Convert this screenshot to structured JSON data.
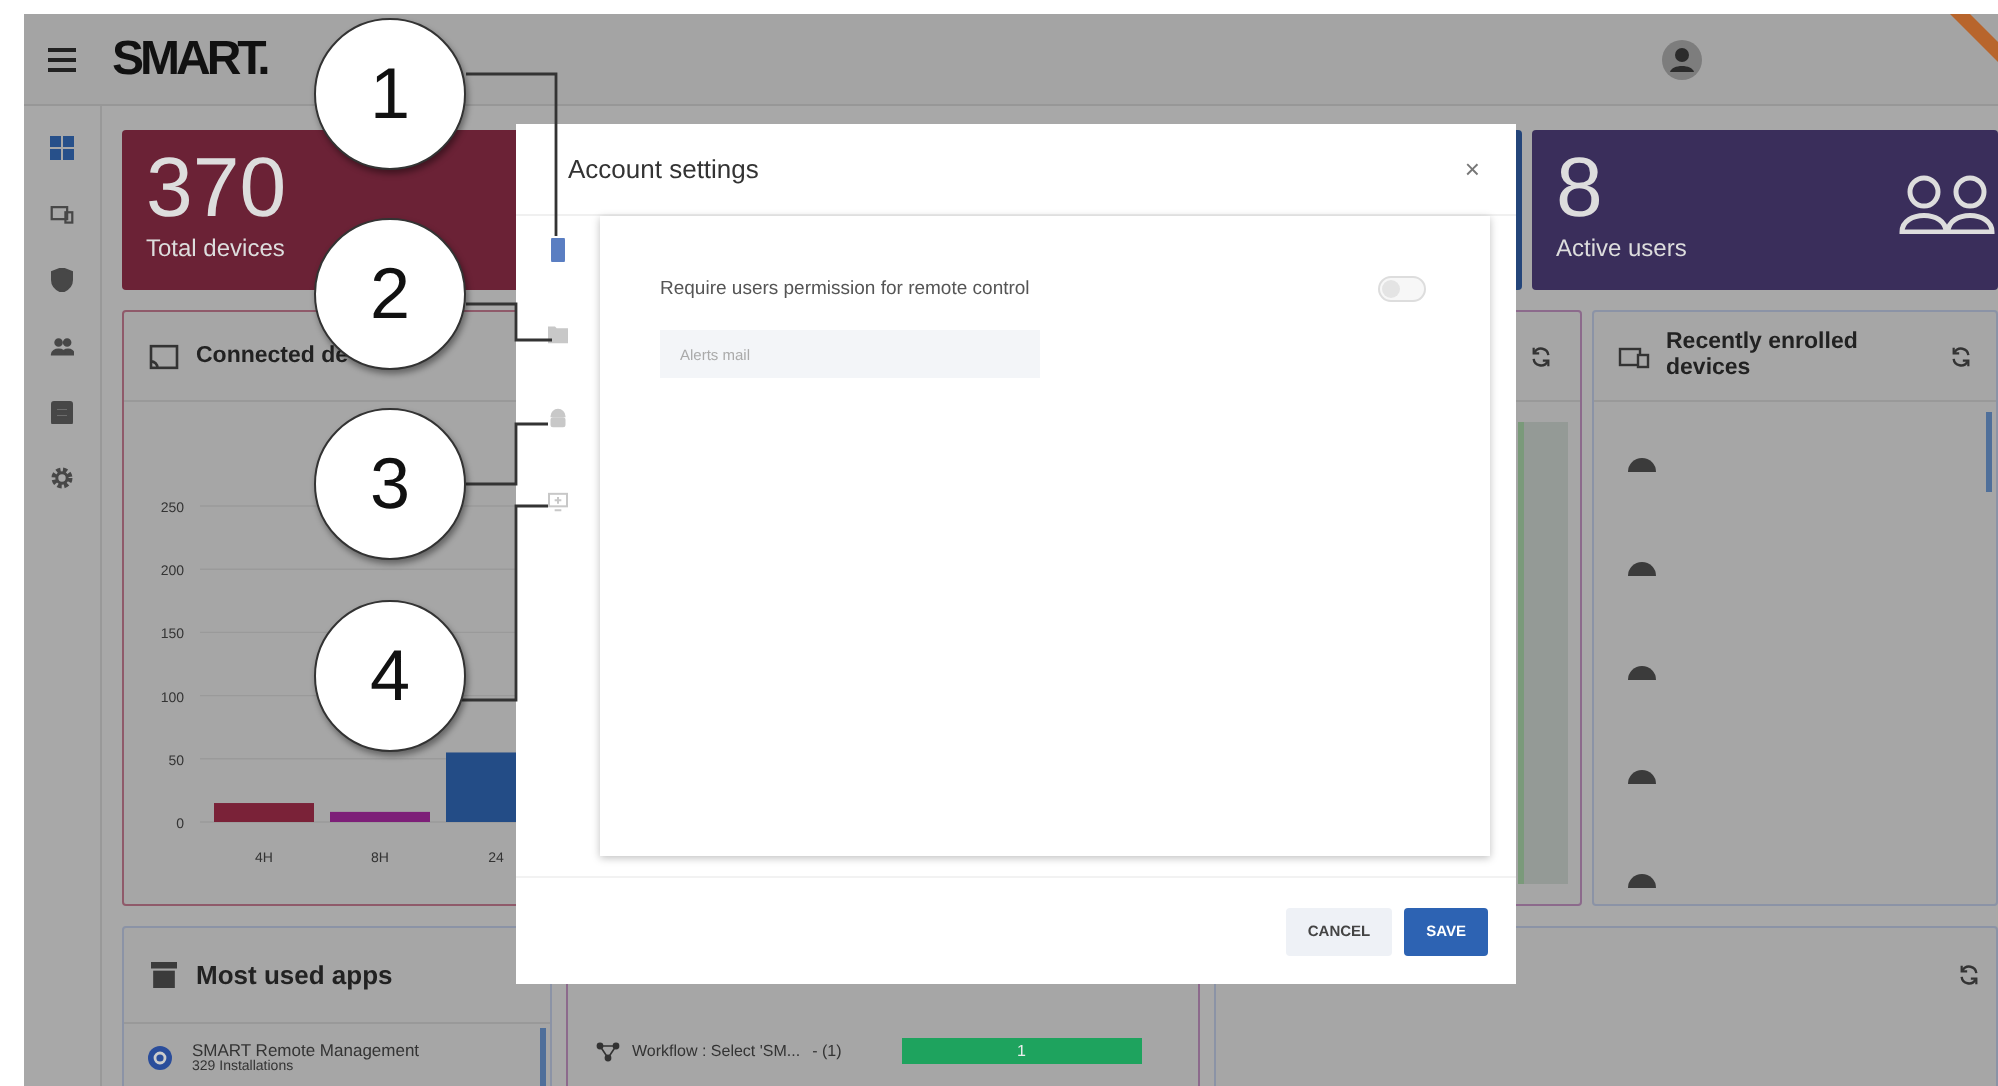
{
  "header": {
    "logo": "SMART."
  },
  "sidebar": {
    "items": [
      {
        "kind": "dashboard",
        "selected": true
      },
      {
        "kind": "devices",
        "selected": false
      },
      {
        "kind": "shield",
        "selected": false
      },
      {
        "kind": "users",
        "selected": false
      },
      {
        "kind": "clipboard",
        "selected": false
      },
      {
        "kind": "settings",
        "selected": false
      }
    ]
  },
  "stats": [
    {
      "value": "370",
      "label": "Total devices",
      "color": "#6b2236"
    },
    {
      "value": "8",
      "label": "Active users",
      "color": "#3a2e5b"
    }
  ],
  "connected_devices": {
    "title": "Connected de",
    "chart_data": {
      "type": "bar",
      "categories": [
        "4H",
        "8H",
        "24"
      ],
      "values": [
        15,
        8,
        55
      ],
      "ylim": [
        0,
        250
      ],
      "grid": true,
      "yticks": [
        0,
        50,
        100,
        150,
        200,
        250
      ]
    }
  },
  "recent": {
    "title": "Recently enrolled devices",
    "rows": [
      {
        "kind": "android"
      },
      {
        "kind": "android"
      },
      {
        "kind": "android"
      },
      {
        "kind": "android"
      },
      {
        "kind": "android"
      }
    ]
  },
  "apps": {
    "title": "Most used apps",
    "items": [
      {
        "name": "SMART Remote Management",
        "detail": "329 Installations"
      }
    ]
  },
  "workflow": {
    "rows": [
      {
        "name": "Workflow : Select 'SM...",
        "count": "- (1)",
        "bar": "1"
      }
    ]
  },
  "modal": {
    "title": "Account settings",
    "close": "×",
    "nav": [
      {
        "kind": "device",
        "selected": true
      },
      {
        "kind": "folder",
        "selected": false
      },
      {
        "kind": "android",
        "selected": false
      },
      {
        "kind": "display",
        "selected": false
      }
    ],
    "setting": {
      "label": "Require users permission for remote control",
      "on": false
    },
    "field": {
      "placeholder": "Alerts mail"
    },
    "buttons": [
      {
        "label": "CANCEL",
        "kind": "secondary"
      },
      {
        "label": "SAVE",
        "kind": "primary"
      }
    ]
  },
  "callouts": [
    "1",
    "2",
    "3",
    "4"
  ]
}
